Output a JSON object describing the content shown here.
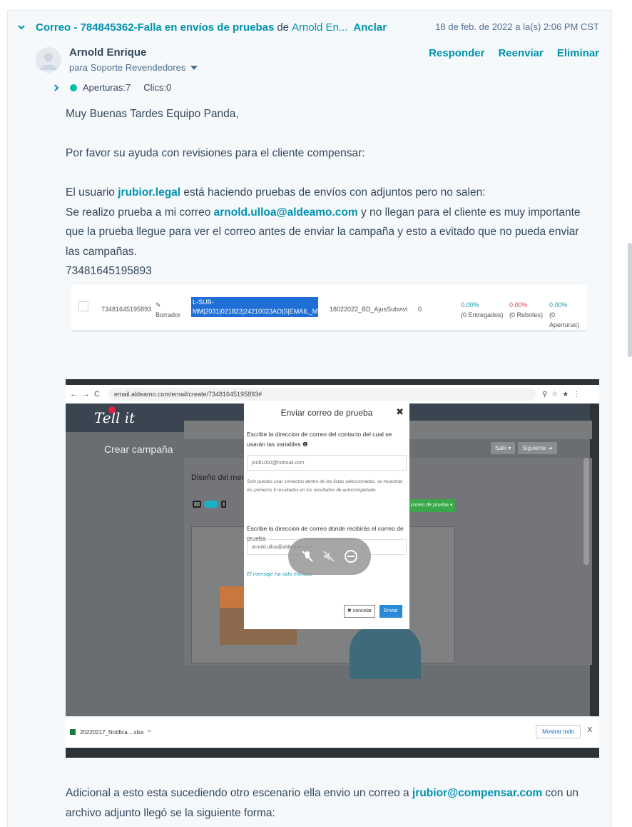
{
  "email": {
    "subject": "Correo - 784845362-Falla en envíos de pruebas",
    "from_word": "de",
    "from_truncated": "Arnold En...",
    "pin_label": "Anclar",
    "date": "18 de feb. de 2022 a la(s) 2:06 PM CST",
    "sender": "Arnold Enrique",
    "recipient": "para Soporte Revendedores",
    "actions": {
      "reply": "Responder",
      "forward": "Reenviar",
      "delete": "Eliminar"
    },
    "stats": {
      "opens": "Aperturas:7",
      "clicks": "Clics:0"
    },
    "greeting": "Muy Buenas Tardes Equipo Panda,",
    "request": "Por favor su ayuda con revisiones para el cliente compensar:",
    "line1_pre": "El usuario ",
    "user_link": "jrubior.legal",
    "line1_post": " está haciendo pruebas de envíos con adjuntos pero no salen:",
    "line2_pre": "Se realizo prueba a mi correo ",
    "email_link": "arnold.ulloa@aldeamo.com",
    "line2_post": " y no llegan para el cliente es muy importante que la prueba llegue para ver el correo antes de enviar la campaña y esto a evitado que no pueda enviar las campañas.",
    "campaign_id": "73481645195893",
    "line3_pre": "Adicional a esto esta sucediendo otro escenario ella envio un correo a ",
    "compensar_link": "jrubior@compensar.com",
    "line3_post": " con un archivo adjunto llegó se la siguiente forma:"
  },
  "shot1": {
    "id": "73481645195893",
    "draft_label": "Borrador",
    "selected_text": "L-SUB-MM|2031|021822|24210023AO|S|EMAIL_MT|NDI",
    "name": "18022022_BD_AjusSubvivi",
    "count": "0",
    "delivered_pct": "0.00%",
    "delivered_lbl": "(0 Entregados)",
    "bounced_pct": "0.00%",
    "bounced_lbl": "(0 Rebotes)",
    "opens_pct": "0.00%",
    "opens_lbl": "(0 Aperturas)"
  },
  "shot2": {
    "url": "email.aldeamo.com/email/create/73481645195893#",
    "logo": "Tell it",
    "create_campaign": "Crear campaña",
    "exit_btn": "Salir ▾",
    "next_btn": "Siguiente ➔",
    "design_label": "Diseño del mensa",
    "modal_title": "Enviar correo de prueba",
    "label_contact": "Escribe la direccion de correo del contacto del cual se usarán las variables ❶",
    "contact_value": "jordi1002@hotmail.com",
    "hint": "Solo puedes usar contactos dentro de las listas seleccionadas, se muestran los primeros 5 resultados en los resultados de autocompletado",
    "label_dest": "Escribe la direccion de correo donde recibirás el correo de prueba",
    "dest_value": "arnold.ulloa@aldeamo.com",
    "sent_msg": "El mensaje ha sido enviado",
    "cancel_btn": "✖ cancelar",
    "send_btn": "Enviar",
    "test_btn": "correo de prueba ▾",
    "download_file": "20220217_Notifica....xlsx",
    "show_all": "Mostrar todo",
    "close": "X"
  },
  "colors": {
    "accent": "#0091ae",
    "text": "#33475b",
    "open_dot": "#00bda5",
    "red": "#d9434b"
  }
}
